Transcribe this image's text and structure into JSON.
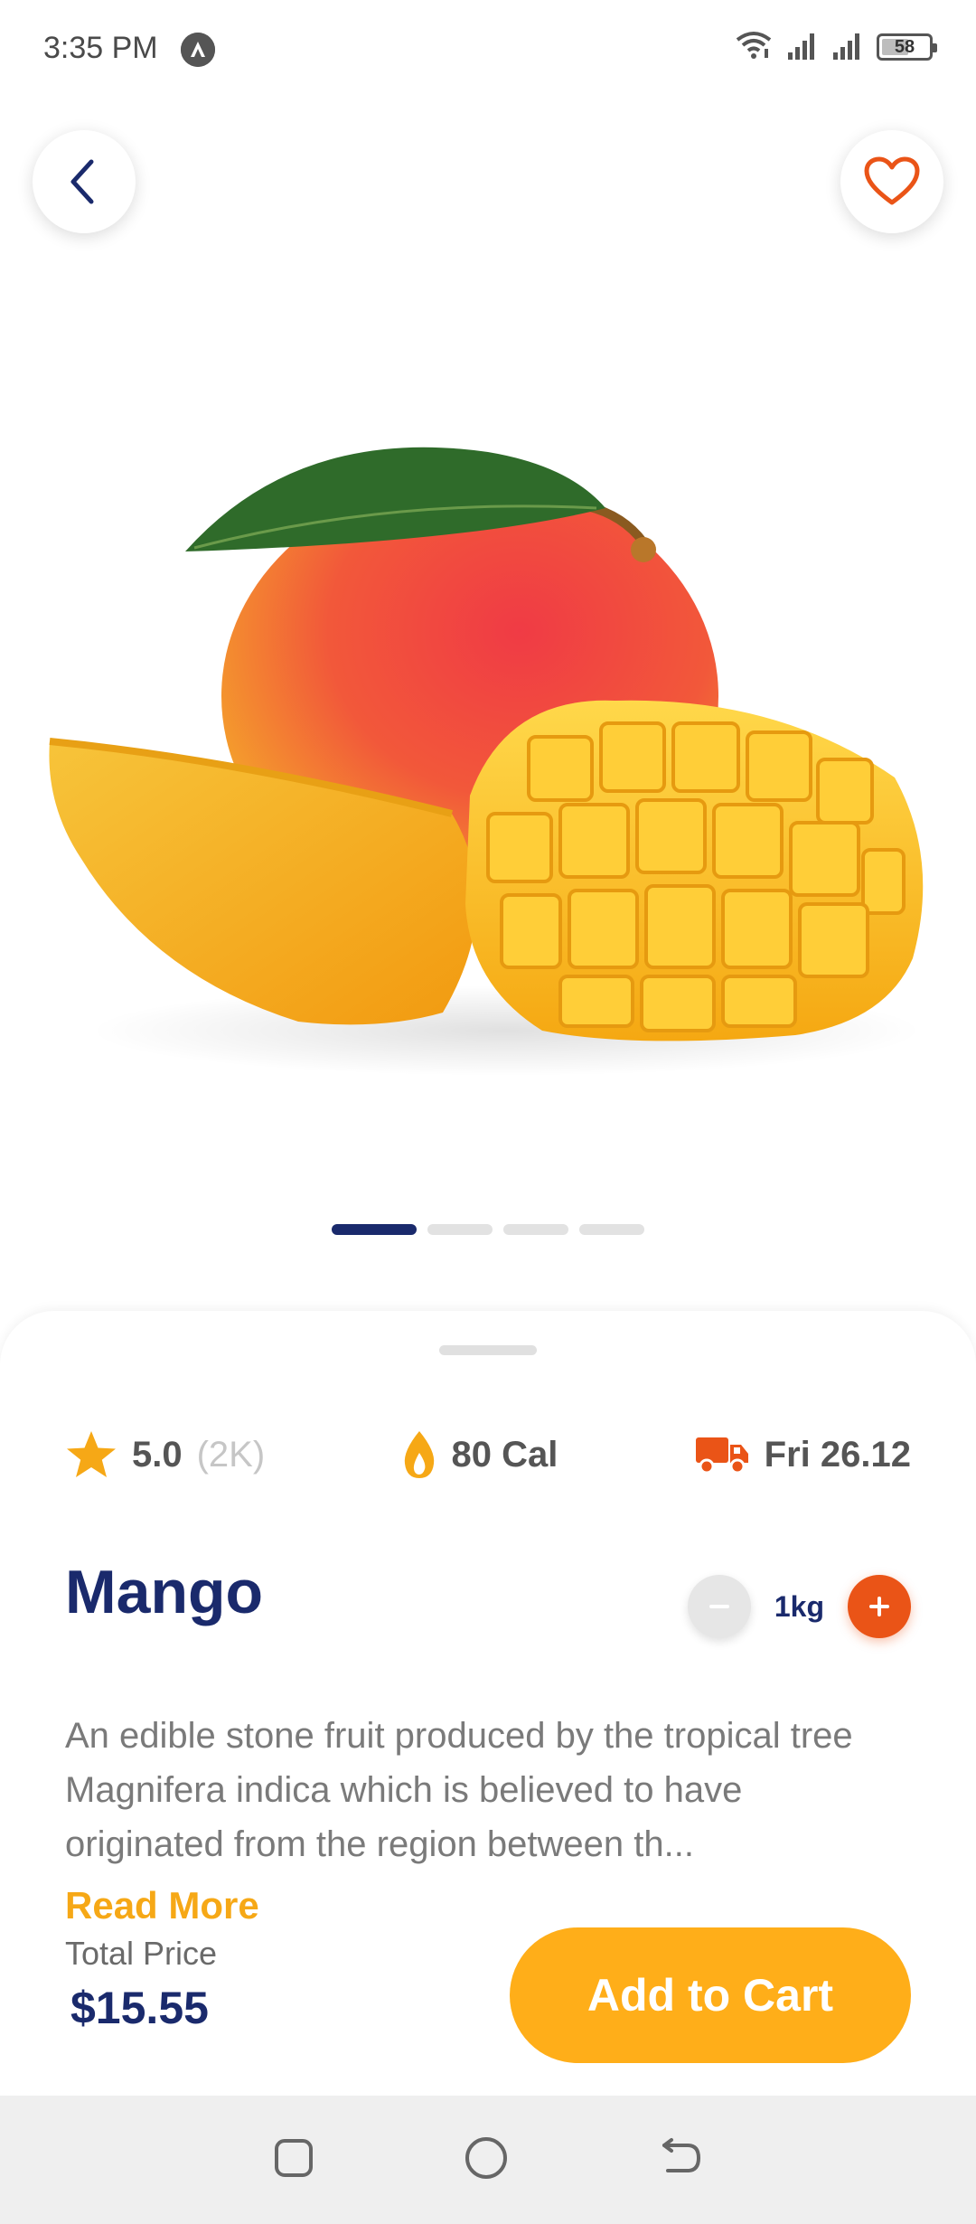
{
  "status_bar": {
    "time": "3:35 PM",
    "battery": "58",
    "battery_level": 0.58,
    "icons": [
      "app-notification-icon",
      "wifi-icon",
      "signal-icon",
      "signal-icon",
      "battery-icon"
    ]
  },
  "header": {
    "back_icon": "chevron-left-icon",
    "favorite_icon": "heart-outline-icon"
  },
  "carousel": {
    "total": 4,
    "active_index": 0
  },
  "stats": {
    "rating": "5.0",
    "rating_count": "(2K)",
    "calories": "80 Cal",
    "delivery": "Fri 26.12"
  },
  "product": {
    "name": "Mango",
    "quantity": "1kg",
    "description": "An edible stone fruit produced by the tropical tree Magnifera indica which is believed to have originated from the region between th...",
    "read_more": "Read More",
    "total_label": "Total Price",
    "total_price": "$15.55",
    "add_to_cart": "Add to Cart"
  },
  "colors": {
    "primary": "#1a2a6c",
    "accent": "#ffae19",
    "orange": "#ea5417",
    "star": "#f6a816"
  }
}
